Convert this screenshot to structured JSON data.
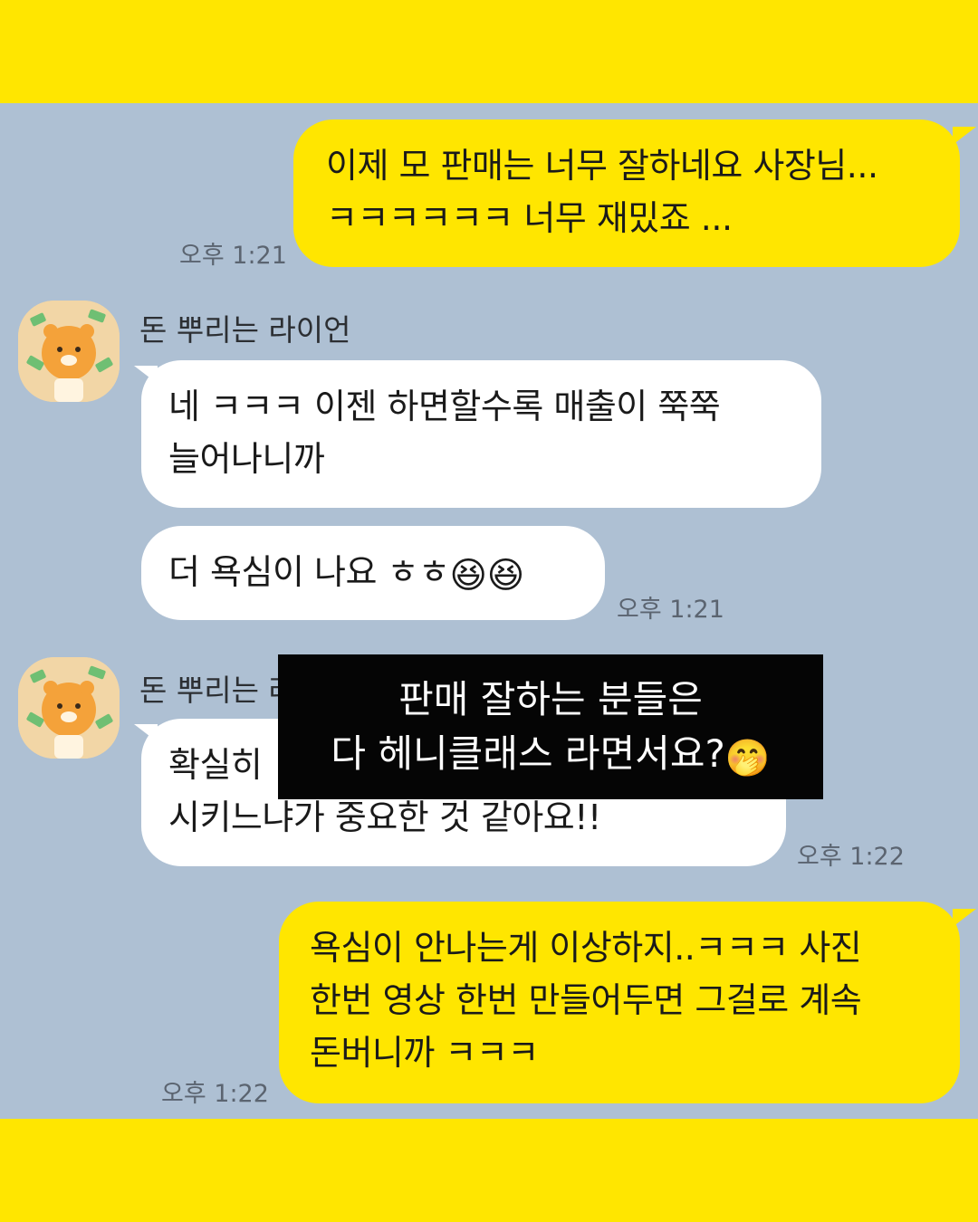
{
  "messages": {
    "m1": {
      "line1": "이제 모 판매는 너무 잘하네요 사장님...",
      "line2": "ㅋㅋㅋㅋㅋㅋ 너무 재밌죠 ...",
      "time": "오후 1:21"
    },
    "sender1": {
      "name": "돈 뿌리는 라이언"
    },
    "m2": {
      "line1": "네 ㅋㅋㅋ 이젠 하면할수록 매출이 쭉쭉",
      "line2": "늘어나니까"
    },
    "m3": {
      "text": "더 욕심이 나요 ㅎㅎ",
      "emoji": "😆😆",
      "time": "오후 1:21"
    },
    "sender2": {
      "name": "돈 뿌리는 라이언"
    },
    "m4": {
      "line1": "확실히",
      "line2": "시키느냐가 중요한 것 같아요!!",
      "time": "오후 1:22"
    },
    "m5": {
      "line1": "욕심이 안나는게 이상하지..ㅋㅋㅋ 사진",
      "line2": "한번 영상 한번 만들어두면 그걸로 계속",
      "line3": "돈버니까 ㅋㅋㅋ",
      "time": "오후 1:22"
    }
  },
  "overlay": {
    "line1": "판매 잘하는 분들은",
    "line2": "다 헤니클래스 라면서요?",
    "emoji": "🤭"
  },
  "colors": {
    "chat_bg": "#AEC0D3",
    "my_bubble": "#FFE600",
    "other_bubble": "#FFFFFF",
    "frame": "#FFE600",
    "overlay_bg": "#050505"
  },
  "icons": {
    "avatar": "ryan-money-avatar-icon"
  }
}
